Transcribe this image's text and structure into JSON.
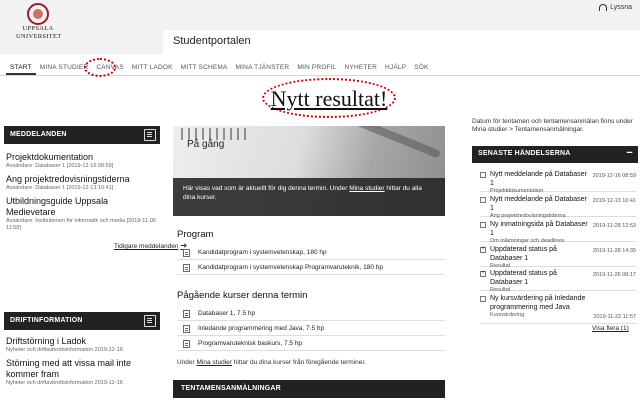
{
  "header": {
    "logo_line1": "UPPSALA",
    "logo_line2": "UNIVERSITET",
    "listen_label": "Lyssna",
    "portal_title": "Studentportalen"
  },
  "nav": {
    "items": [
      "START",
      "MINA STUDIER",
      "CANVAS",
      "MITT LADOK",
      "MITT SCHEMA",
      "MINA TJÄNSTER",
      "MIN PROFIL",
      "NYHETER",
      "HJÄLP",
      "SÖK"
    ]
  },
  "annotation": {
    "text": "Nytt resultat!"
  },
  "messages": {
    "heading": "MEDDELANDEN",
    "items": [
      {
        "title": "Projektdokumentation",
        "meta": "Avsändare: Databaser 1 [2019-12-16 08:59]"
      },
      {
        "title": "Ang projektredovisningstiderna",
        "meta": "Avsändare: Databaser 1 [2019-12-13 10:41]"
      },
      {
        "title": "Utbildningsguide Uppsala Medievetare",
        "meta": "Avsändare: Institutionen för informatik och media [2019-11-06 11:58]"
      }
    ],
    "more_label": "Tidigare meddelanden"
  },
  "operations": {
    "heading": "DRIFTINFORMATION",
    "items": [
      {
        "title": "Driftstörning i Ladok",
        "meta": "Nyheter och driftavbrottsinformation 2019-12-16"
      },
      {
        "title": "Störning med att vissa mail inte kommer fram",
        "meta": "Nyheter och driftavbrottsinformation 2019-12-16"
      }
    ]
  },
  "hero": {
    "title": "På gång",
    "text_before": "Här visas vad som är aktuellt för dig denna termin. Under ",
    "link": "Mina studier",
    "text_after": " hittar du alla dina kurser."
  },
  "program": {
    "heading": "Program",
    "items": [
      "Kandidatprogram i systemvetenskap, 180 hp",
      "Kandidatprogram i systemvetenskap Programvaruteknik, 180 hp"
    ]
  },
  "courses": {
    "heading": "Pågående kurser denna termin",
    "items": [
      "Databaser 1, 7.5 hp",
      "Inledande programmering med Java, 7.5 hp",
      "Programvaruteknisk baskurs, 7.5 hp"
    ],
    "note_before": "Under ",
    "note_link": "Mina studier",
    "note_after": " hittar du dina kurser från föregående terminer."
  },
  "exams": {
    "heading": "TENTAMENSANMÄLNINGAR",
    "note": "Datum för tentamen och tentamensanmälan finns under Mina studier > Tentamensanmälningar."
  },
  "events": {
    "heading": "SENASTE HÄNDELSERNA",
    "items": [
      {
        "title": "Nytt meddelande på Databaser 1",
        "sub": "Projektdokumentation",
        "date": "2019-12-16 08:59",
        "type": "box"
      },
      {
        "title": "Nytt meddelande på Databaser 1",
        "sub": "Ang projektredovisningstiderna",
        "date": "2019-12-13 10:41",
        "type": "box"
      },
      {
        "title": "Ny inmatningsida på Databaser 1",
        "sub": "Om inlämningar och deadlines",
        "date": "2019-11-28 12:53",
        "type": "box"
      },
      {
        "title": "Uppdaterad status på Databaser 1",
        "sub": "Resultat",
        "date": "2019-11-28 14:35",
        "type": "plus"
      },
      {
        "title": "Uppdaterad status på Databaser 1",
        "sub": "Resultat",
        "date": "2019-11-26 08:17",
        "type": "plus"
      },
      {
        "title": "Ny kursvärdering på Inledande programmering med Java",
        "sub": "Kursvärdering",
        "date": "2019-11-22 11:57",
        "type": "box"
      }
    ],
    "show_more": "Visa flera (1)"
  }
}
